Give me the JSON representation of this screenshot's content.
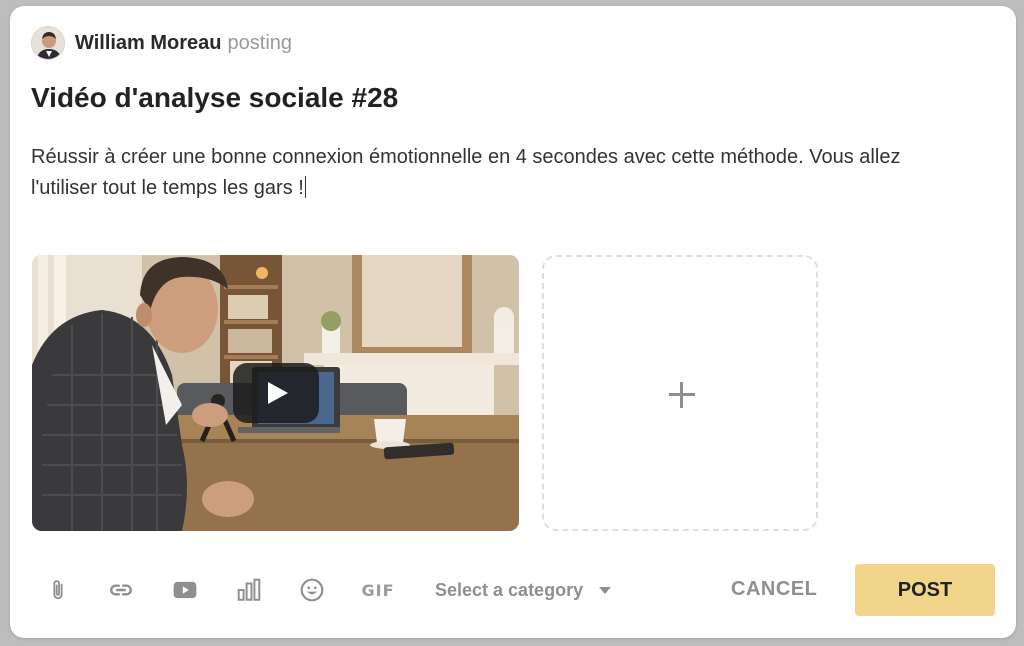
{
  "post": {
    "author": "William Moreau",
    "status": "posting",
    "title": "Vidéo d'analyse sociale #28",
    "body": "Réussir à créer une bonne connexion émotionnelle en 4 secondes avec cette méthode. Vous allez l'utiliser tout le temps les gars !"
  },
  "media": {
    "video_icon": "play-icon",
    "add_icon": "plus-icon"
  },
  "toolbar": {
    "icons": [
      "paperclip-icon",
      "link-icon",
      "youtube-icon",
      "poll-icon",
      "emoji-icon",
      "gif-icon"
    ],
    "gif_label": "GIF",
    "category_placeholder": "Select a category",
    "cancel_label": "CANCEL",
    "post_label": "POST"
  },
  "colors": {
    "accent": "#f1d58a",
    "muted": "#8f8f8f",
    "text": "#222222"
  }
}
